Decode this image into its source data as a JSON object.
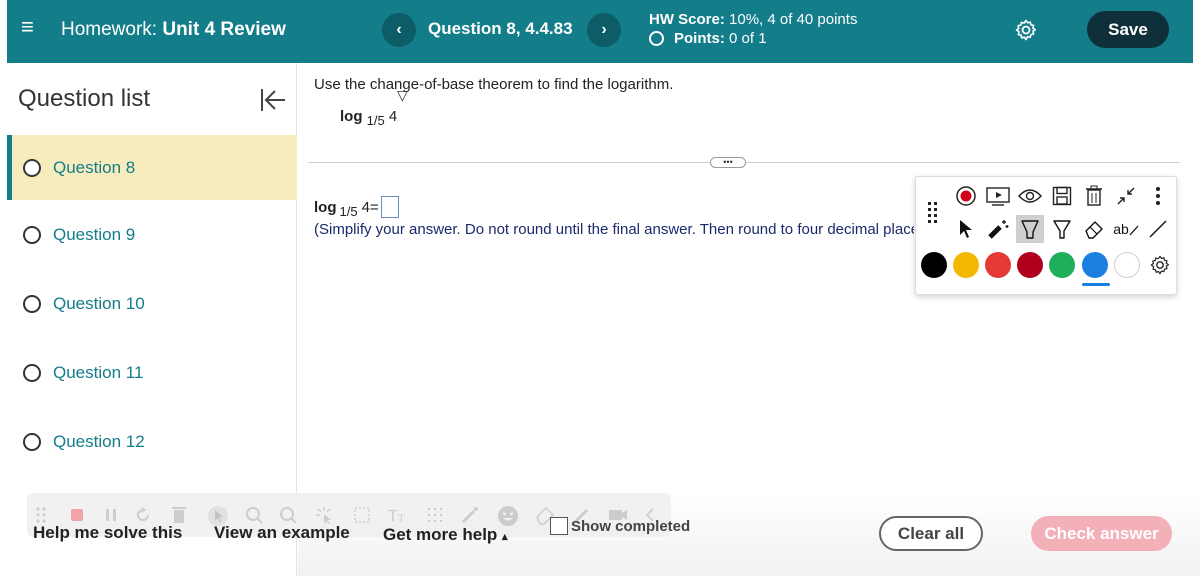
{
  "header": {
    "menu_icon": "hamburger-icon",
    "hw_prefix": "Homework:",
    "hw_name": "Unit 4 Review",
    "prev_glyph": "‹",
    "next_glyph": "›",
    "question_title": "Question 8, 4.4.83",
    "score_label": "HW Score:",
    "score_value": "10%, 4 of 40 points",
    "points_label": "Points:",
    "points_value": "0 of 1",
    "save_label": "Save"
  },
  "sidebar": {
    "title": "Question list",
    "items": [
      {
        "label": "Question 8",
        "active": true
      },
      {
        "label": "Question 9",
        "active": false
      },
      {
        "label": "Question 10",
        "active": false
      },
      {
        "label": "Question 11",
        "active": false
      },
      {
        "label": "Question 12",
        "active": false
      }
    ]
  },
  "main": {
    "instruction": "Use the change-of-base theorem to find the logarithm.",
    "log_word": "log",
    "log_base": "1/5",
    "log_arg": "4",
    "answer_log_word": "log",
    "answer_base": "1/5",
    "answer_arg": "4",
    "answer_equals": "=",
    "answer_value": "",
    "hint": "(Simplify your answer. Do not round until the final answer. Then round to four decimal places as needed.)",
    "divider_handle": "•••"
  },
  "annotation_toolbar": {
    "colors": [
      "#000000",
      "#f5b800",
      "#e53935",
      "#b0001e",
      "#1fae5b",
      "#1b7fe0",
      "#ffffff"
    ],
    "selected_color": "#1b7fe0",
    "text_tool_label": "ab"
  },
  "bottom": {
    "help_solve": "Help me solve this",
    "view_example": "View an example",
    "get_more_help": "Get more help",
    "get_more_help_caret": "▴",
    "show_completed": "Show completed",
    "clear_all": "Clear all",
    "check_answer": "Check answer"
  }
}
